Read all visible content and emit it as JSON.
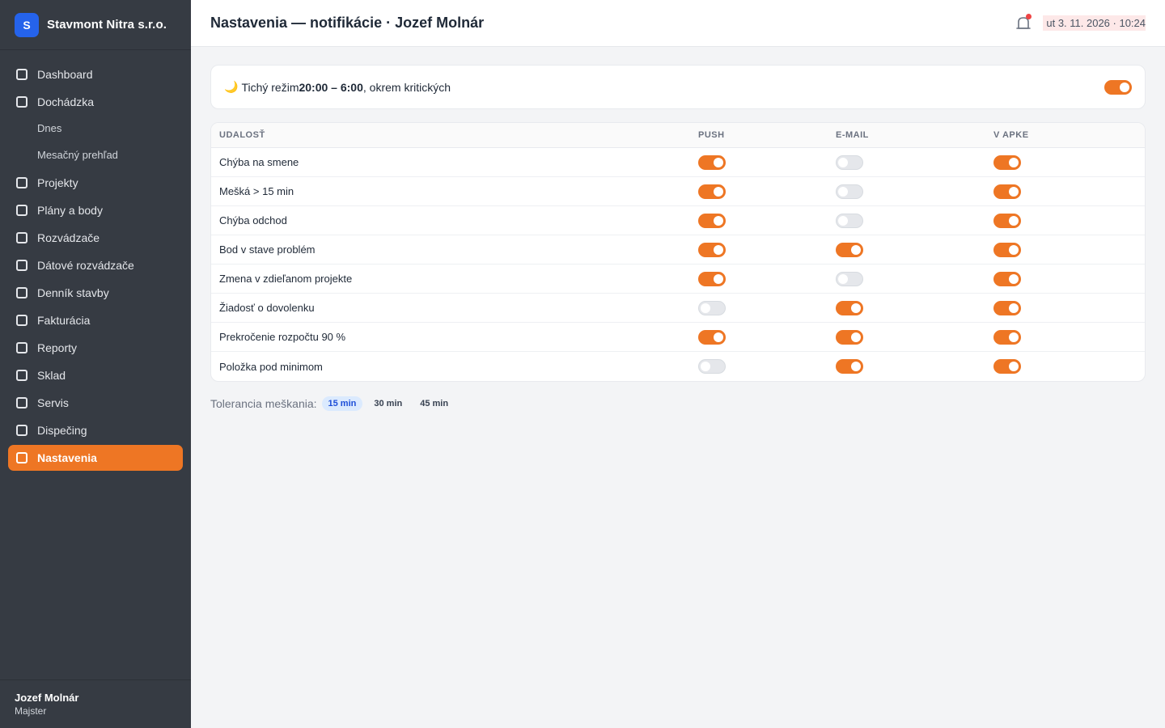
{
  "brand": {
    "logo_letter": "S",
    "name": "Stavmont Nitra s.r.o."
  },
  "sidebar": {
    "items": [
      {
        "label": "Dashboard",
        "type": "item",
        "active": false
      },
      {
        "label": "Dochádzka",
        "type": "item",
        "active": false
      },
      {
        "label": "Dnes",
        "type": "sub",
        "active": false
      },
      {
        "label": "Mesačný prehľad",
        "type": "sub",
        "active": false
      },
      {
        "label": "Projekty",
        "type": "item",
        "active": false
      },
      {
        "label": "Plány a body",
        "type": "item",
        "active": false
      },
      {
        "label": "Rozvádzače",
        "type": "item",
        "active": false
      },
      {
        "label": "Dátové rozvádzače",
        "type": "item",
        "active": false
      },
      {
        "label": "Denník stavby",
        "type": "item",
        "active": false
      },
      {
        "label": "Fakturácia",
        "type": "item",
        "active": false
      },
      {
        "label": "Reporty",
        "type": "item",
        "active": false
      },
      {
        "label": "Sklad",
        "type": "item",
        "active": false
      },
      {
        "label": "Servis",
        "type": "item",
        "active": false
      },
      {
        "label": "Dispečing",
        "type": "item",
        "active": false
      },
      {
        "label": "Nastavenia",
        "type": "item",
        "active": true
      }
    ]
  },
  "user": {
    "name": "Jozef Molnár",
    "role": "Majster"
  },
  "header": {
    "title": "Nastavenia — notifikácie · Jozef Molnár",
    "datetime": "ut 3. 11. 2026 · 10:24",
    "notification_icon": "bell-icon"
  },
  "quiet_mode": {
    "icon": "🌙",
    "prefix": "Tichý režim ",
    "hours": "20:00 – 6:00",
    "suffix": ", okrem kritických",
    "enabled": true
  },
  "table": {
    "columns": {
      "event": "UDALOSŤ",
      "push": "PUSH",
      "email": "E-MAIL",
      "app": "V APKE"
    },
    "rows": [
      {
        "event": "Chýba na smene",
        "push": true,
        "email": false,
        "app": true
      },
      {
        "event": "Mešká > 15 min",
        "push": true,
        "email": false,
        "app": true
      },
      {
        "event": "Chýba odchod",
        "push": true,
        "email": false,
        "app": true
      },
      {
        "event": "Bod v stave problém",
        "push": true,
        "email": true,
        "app": true
      },
      {
        "event": "Zmena v zdieľanom projekte",
        "push": true,
        "email": false,
        "app": true
      },
      {
        "event": "Žiadosť o dovolenku",
        "push": false,
        "email": true,
        "app": true
      },
      {
        "event": "Prekročenie rozpočtu 90 %",
        "push": true,
        "email": true,
        "app": true
      },
      {
        "event": "Položka pod minimom",
        "push": false,
        "email": true,
        "app": true
      }
    ]
  },
  "tolerance": {
    "label": "Tolerancia meškania:",
    "options": [
      "15 min",
      "30 min",
      "45 min"
    ],
    "selected": "15 min"
  },
  "colors": {
    "accent": "#ee7624",
    "sidebar": "#363b43",
    "brand": "#2563eb"
  }
}
